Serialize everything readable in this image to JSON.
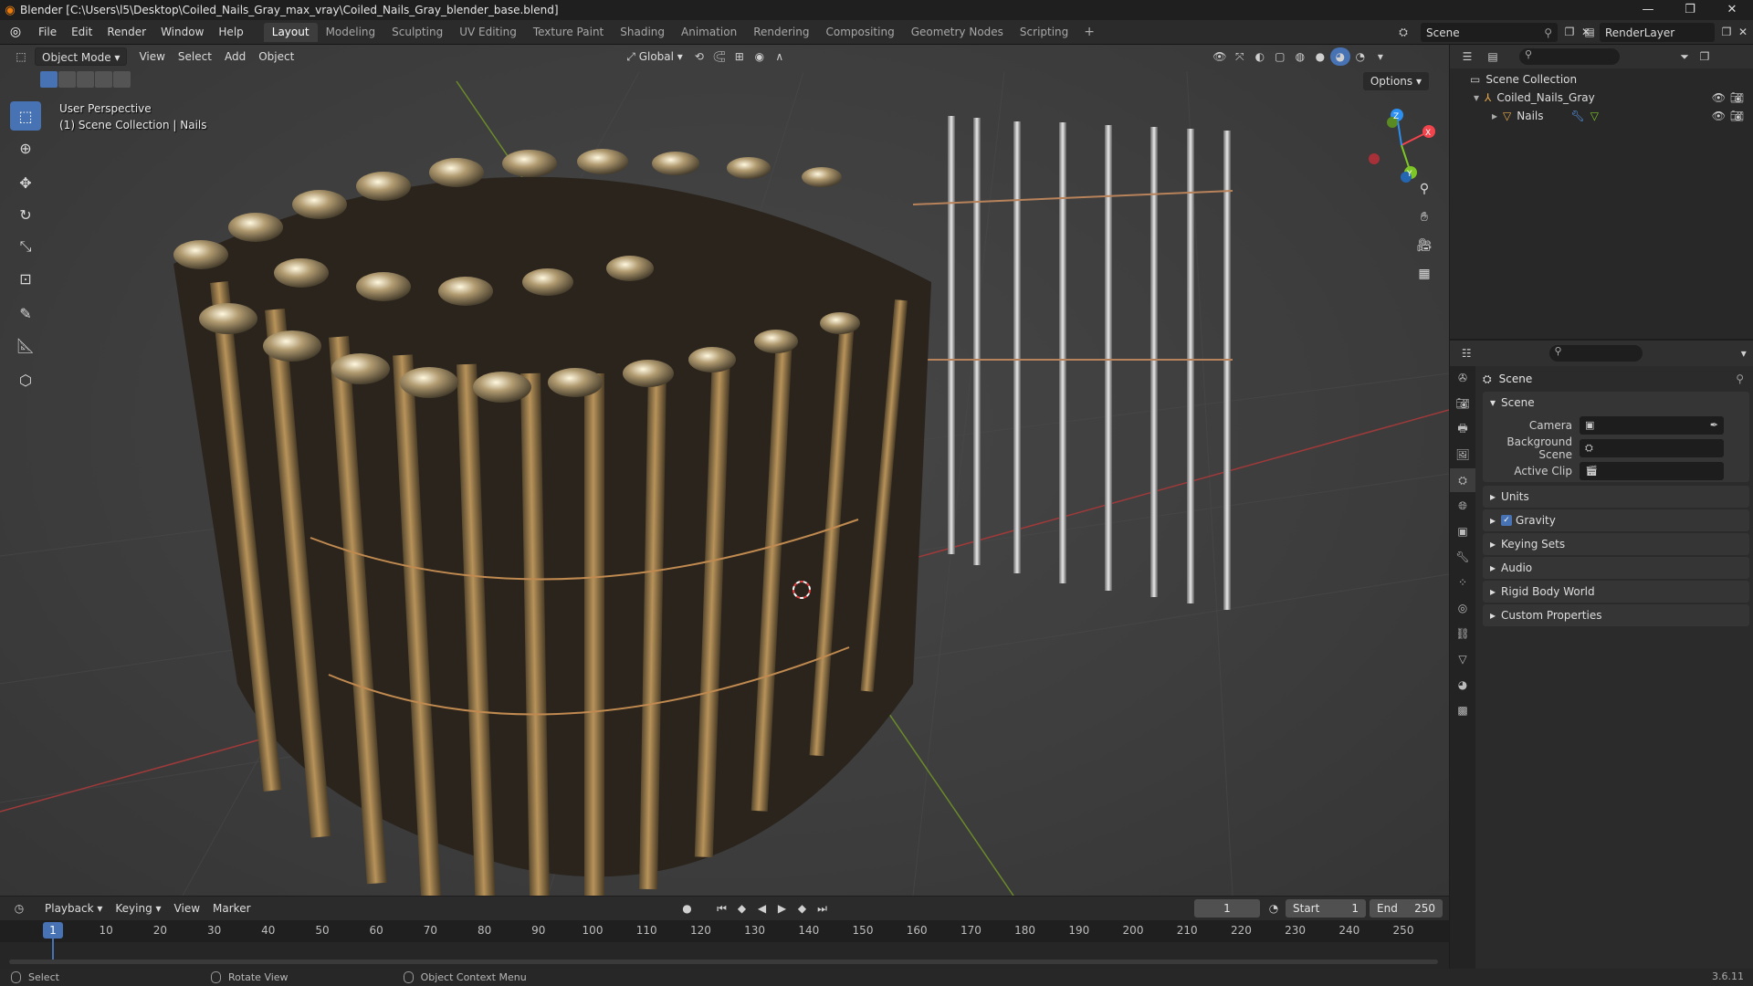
{
  "window": {
    "title": "Blender [C:\\Users\\l5\\Desktop\\Coiled_Nails_Gray_max_vray\\Coiled_Nails_Gray_blender_base.blend]",
    "controls": [
      "—",
      "❐",
      "✕"
    ]
  },
  "menu": [
    "File",
    "Edit",
    "Render",
    "Window",
    "Help"
  ],
  "workspaces": [
    "Layout",
    "Modeling",
    "Sculpting",
    "UV Editing",
    "Texture Paint",
    "Shading",
    "Animation",
    "Rendering",
    "Compositing",
    "Geometry Nodes",
    "Scripting"
  ],
  "active_workspace": "Layout",
  "scene_name": "Scene",
  "render_layer": "RenderLayer",
  "viewport": {
    "mode": "Object Mode",
    "menus": [
      "View",
      "Select",
      "Add",
      "Object"
    ],
    "orientation": "Global",
    "options_label": "Options",
    "overlay_line1": "User Perspective",
    "overlay_line2": "(1) Scene Collection | Nails",
    "gizmo_axes": {
      "x": "X",
      "y": "Y",
      "z": "Z"
    }
  },
  "outliner": {
    "root": "Scene Collection",
    "items": [
      {
        "label": "Coiled_Nails_Gray"
      },
      {
        "label": "Nails"
      }
    ]
  },
  "properties": {
    "context": "Scene",
    "panel_title": "Scene",
    "fields": [
      {
        "label": "Camera",
        "value": ""
      },
      {
        "label": "Background Scene",
        "value": ""
      },
      {
        "label": "Active Clip",
        "value": ""
      }
    ],
    "sections": [
      "Units",
      "Gravity",
      "Keying Sets",
      "Audio",
      "Rigid Body World",
      "Custom Properties"
    ]
  },
  "timeline": {
    "menus": [
      "Playback",
      "Keying",
      "View",
      "Marker"
    ],
    "current_frame": "1",
    "start_label": "Start",
    "start": "1",
    "end_label": "End",
    "end": "250",
    "ticks": [
      "10",
      "20",
      "30",
      "40",
      "50",
      "60",
      "70",
      "80",
      "90",
      "100",
      "110",
      "120",
      "130",
      "140",
      "150",
      "160",
      "170",
      "180",
      "190",
      "200",
      "210",
      "220",
      "230",
      "240",
      "250"
    ]
  },
  "status": {
    "items": [
      "Select",
      "Rotate View",
      "Object Context Menu"
    ],
    "version": "3.6.11"
  },
  "colors": {
    "accent": "#4772b3",
    "x_axis": "#f2444d",
    "y_axis": "#7ec626",
    "z_axis": "#2c8ff2",
    "brass": "#b8935a",
    "steel": "#c8c8c8"
  }
}
